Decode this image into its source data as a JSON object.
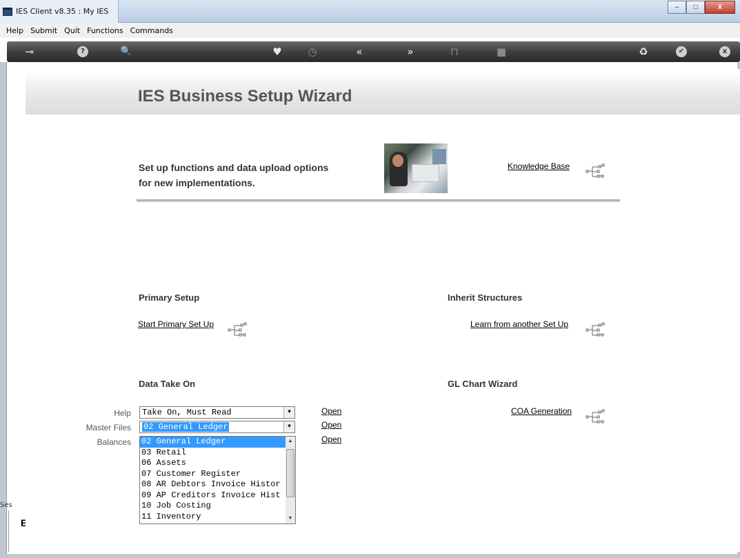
{
  "window": {
    "title": "IES Client v8.35 : My IES",
    "minimize_glyph": "–",
    "maximize_glyph": "□",
    "close_glyph": "X"
  },
  "menu": [
    "Help",
    "Submit",
    "Quit",
    "Functions",
    "Commands"
  ],
  "toolbar": {
    "icons": [
      "key-icon",
      "help-icon",
      "search-icon",
      "heart-icon",
      "clock-icon",
      "back-icon",
      "forward-icon",
      "tools-icon",
      "stop-icon",
      "recycle-icon",
      "check-icon",
      "close-icon"
    ],
    "glyphs": {
      "key": "⊸",
      "help": "?",
      "search": "🔍",
      "heart": "♥",
      "clock": "◷",
      "back": "«",
      "forward": "»",
      "tools": "⊓",
      "stop": "■",
      "recycle": "♻",
      "check": "✔",
      "close": "x"
    }
  },
  "page": {
    "title": "IES Business Setup Wizard",
    "intro_line1": "Set up functions and data upload options",
    "intro_line2": "for new implementations.",
    "knowledge_base_link": "Knowledge Base"
  },
  "sections": {
    "primary_setup": {
      "title": "Primary Setup",
      "link": "Start Primary Set Up"
    },
    "inherit_structures": {
      "title": "Inherit Structures",
      "link": "Learn from another Set Up"
    },
    "data_take_on": {
      "title": "Data Take On",
      "help_label": "Help",
      "help_value": "Take On, Must Read",
      "master_files_label": "Master Files",
      "master_files_value": "02 General Ledger",
      "balances_label": "Balances",
      "open_label": "Open",
      "list_items": [
        "02 General Ledger",
        "03 Retail",
        "06 Assets",
        "07 Customer Register",
        "08 AR Debtors Invoice Histor",
        "09 AP Creditors Invoice Hist",
        "10 Job Costing",
        "11 Inventory"
      ]
    },
    "gl_chart_wizard": {
      "title": "GL Chart Wizard",
      "link": "COA Generation"
    }
  },
  "session": {
    "label": "Ses",
    "glyph": "E"
  },
  "colors": {
    "selection": "#3399ff",
    "title_gray": "#555555",
    "toolbar_dark": "#3f3f3f"
  }
}
